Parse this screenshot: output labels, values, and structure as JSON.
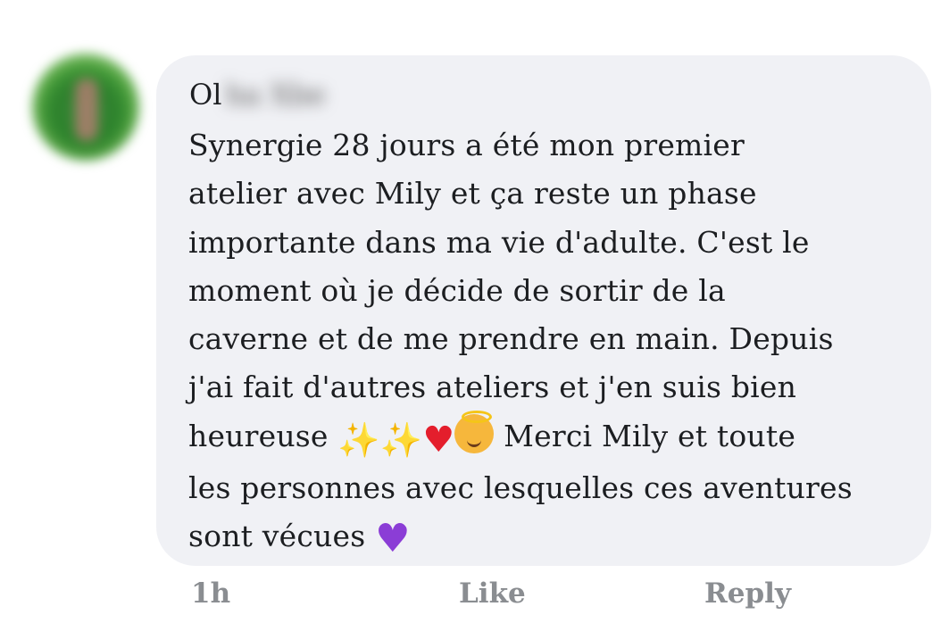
{
  "comment": {
    "author_visible": "Ol",
    "author_blurred": "ha Xbe",
    "lines": [
      "Synergie 28 jours a été mon premier",
      "atelier avec Mily et ça reste un phase",
      "importante dans ma vie d'adulte. C'est le",
      "moment où je décide de sortir de la",
      "caverne et de me prendre en main. Depuis",
      "j'ai fait d'autres ateliers et j'en suis bien"
    ],
    "line7_text": "heureuse",
    "line7_emojis": {
      "sparkles1": "✨",
      "sparkles2": "✨",
      "heart": "♥"
    },
    "line7_after": "Merci Mily et toute",
    "line8": "les personnes avec lesquelles ces aventures",
    "line9_text": "sont vécues",
    "purple_heart": "♥",
    "emoji_names": [
      "sparkles-icon",
      "sparkles-icon",
      "red-heart-icon",
      "smiling-face-with-halo-icon",
      "purple-heart-icon"
    ]
  },
  "actions": {
    "time": "1h",
    "like": "Like",
    "reply": "Reply"
  },
  "colors": {
    "bubble": "#f0f1f5",
    "text": "#1c1e21",
    "meta": "#8a8d91",
    "heart_red": "#e41e2c",
    "heart_purple": "#8b3dd6"
  }
}
